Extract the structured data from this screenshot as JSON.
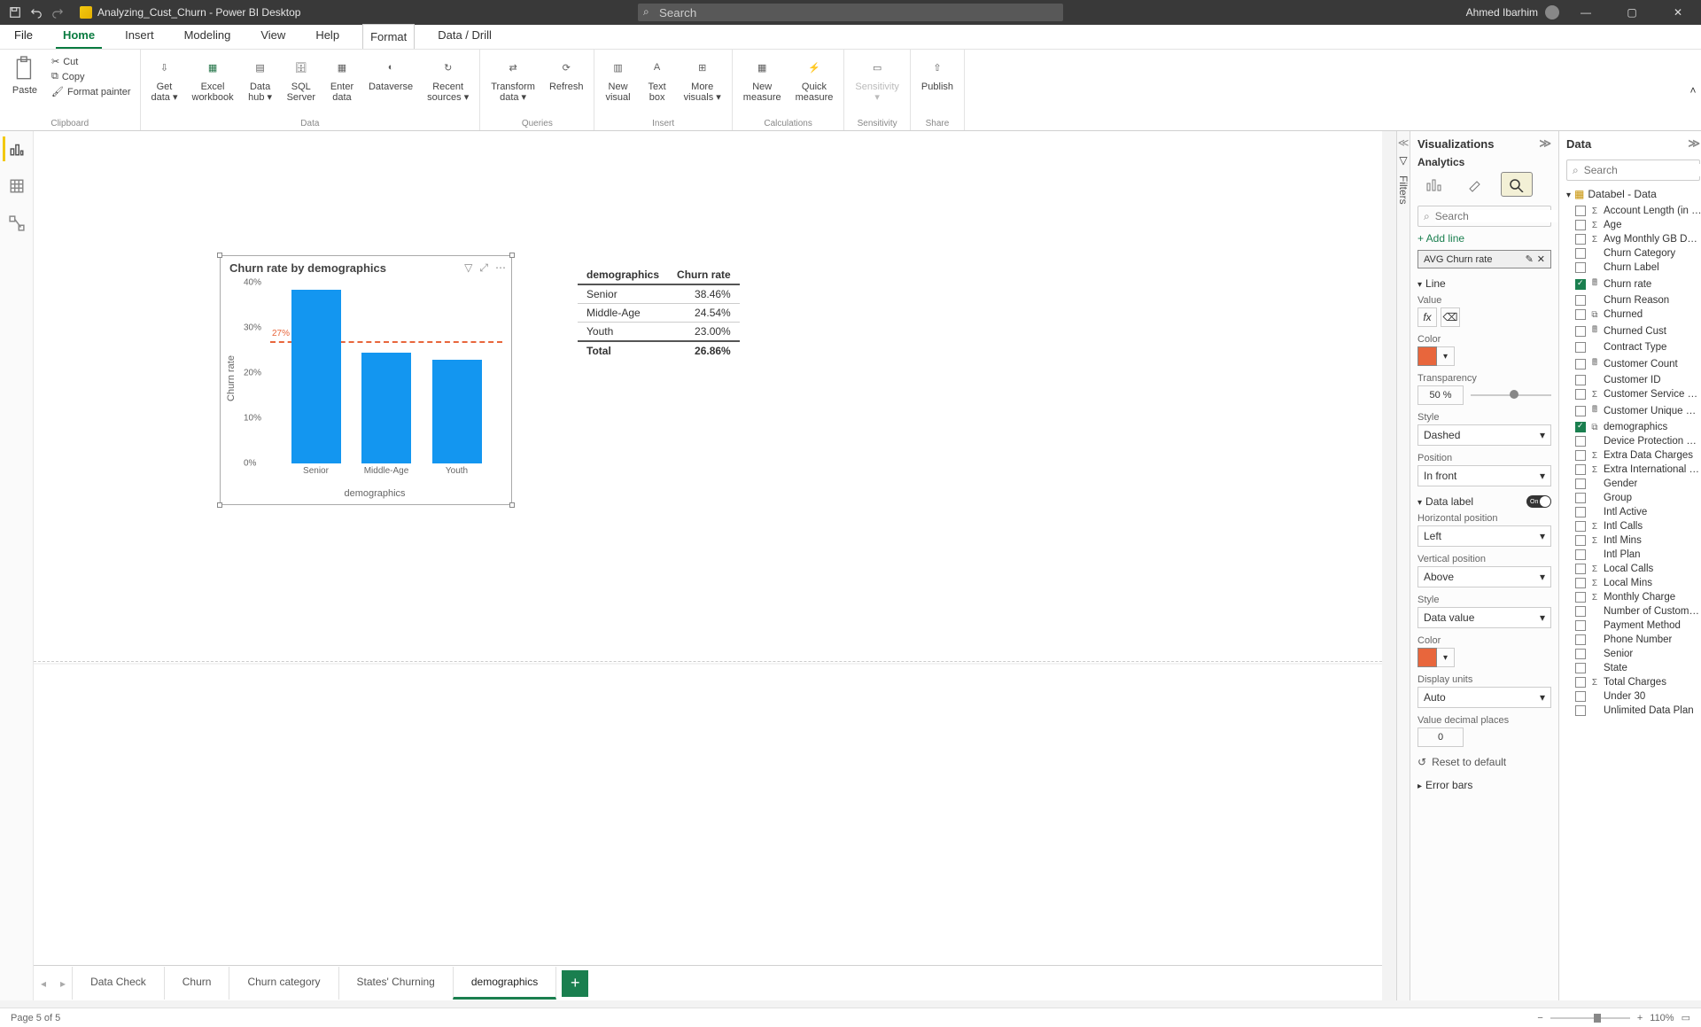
{
  "titlebar": {
    "doc_name": "Analyzing_Cust_Churn - Power BI Desktop",
    "search_placeholder": "Search",
    "user_name": "Ahmed Ibarhim"
  },
  "menus": [
    "File",
    "Home",
    "Insert",
    "Modeling",
    "View",
    "Help",
    "Format",
    "Data / Drill"
  ],
  "ribbon": {
    "clipboard": {
      "paste": "Paste",
      "cut": "Cut",
      "copy": "Copy",
      "format_painter": "Format painter",
      "group": "Clipboard"
    },
    "data": {
      "get": "Get\ndata ▾",
      "excel": "Excel\nworkbook",
      "datahub": "Data\nhub ▾",
      "sql": "SQL\nServer",
      "enter": "Enter\ndata",
      "dataverse": "Dataverse",
      "recent": "Recent\nsources ▾",
      "group": "Data"
    },
    "queries": {
      "transform": "Transform\ndata ▾",
      "refresh": "Refresh",
      "group": "Queries"
    },
    "insert": {
      "visual": "New\nvisual",
      "textbox": "Text\nbox",
      "more": "More\nvisuals ▾",
      "group": "Insert"
    },
    "calculations": {
      "measure": "New\nmeasure",
      "quick": "Quick\nmeasure",
      "group": "Calculations"
    },
    "sensitivity": {
      "label": "Sensitivity\n▾",
      "group": "Sensitivity"
    },
    "share": {
      "publish": "Publish",
      "group": "Share"
    }
  },
  "chart_data": {
    "type": "bar",
    "title": "Churn rate by demographics",
    "ylabel": "Churn rate",
    "xlabel": "demographics",
    "ylim": [
      0,
      40
    ],
    "yticks": [
      0,
      10,
      20,
      30,
      40
    ],
    "categories": [
      "Senior",
      "Middle-Age",
      "Youth"
    ],
    "values": [
      38.46,
      24.54,
      23.0
    ],
    "reference_line": {
      "value": 27,
      "label": "27%"
    }
  },
  "summary_table": {
    "headers": [
      "demographics",
      "Churn rate"
    ],
    "rows": [
      [
        "Senior",
        "38.46%"
      ],
      [
        "Middle-Age",
        "24.54%"
      ],
      [
        "Youth",
        "23.00%"
      ]
    ],
    "total": [
      "Total",
      "26.86%"
    ]
  },
  "page_tabs": {
    "tabs": [
      "Data Check",
      "Churn",
      "Churn category",
      "States' Churning",
      "demographics"
    ],
    "active_index": 4
  },
  "status": {
    "page": "Page 5 of 5",
    "zoom": "110%"
  },
  "filters_rail": {
    "label": "Filters"
  },
  "viz_pane": {
    "title": "Visualizations",
    "subtab": "Analytics",
    "search_placeholder": "Search",
    "add_line": "+ Add line",
    "line_chip": "AVG Churn rate",
    "sections": {
      "line": "Line",
      "value_label": "Value",
      "color_label": "Color",
      "transparency_label": "Transparency",
      "transparency_val": "50 %",
      "style_label": "Style",
      "style_val": "Dashed",
      "position_label": "Position",
      "position_val": "In front",
      "datalabel": "Data label",
      "datalabel_toggle": "On",
      "hpos_label": "Horizontal position",
      "hpos_val": "Left",
      "vpos_label": "Vertical position",
      "vpos_val": "Above",
      "dstyle_label": "Style",
      "dstyle_val": "Data value",
      "dcolor_label": "Color",
      "dunits_label": "Display units",
      "dunits_val": "Auto",
      "vdec_label": "Value decimal places",
      "vdec_val": "0",
      "reset": "Reset to default",
      "errorbars": "Error bars"
    }
  },
  "data_pane": {
    "title": "Data",
    "search_placeholder": "Search",
    "table": "Databel - Data",
    "fields": [
      {
        "name": "Account Length (in mont...",
        "sigma": true,
        "checked": false
      },
      {
        "name": "Age",
        "sigma": true,
        "checked": false
      },
      {
        "name": "Avg Monthly GB Download",
        "sigma": true,
        "checked": false
      },
      {
        "name": "Churn Category",
        "sigma": false,
        "checked": false
      },
      {
        "name": "Churn Label",
        "sigma": false,
        "checked": false
      },
      {
        "name": "Churn rate",
        "sigma": false,
        "icon": "calc",
        "checked": true
      },
      {
        "name": "Churn Reason",
        "sigma": false,
        "checked": false
      },
      {
        "name": "Churned",
        "sigma": false,
        "icon": "hier",
        "checked": false
      },
      {
        "name": "Churned Cust",
        "sigma": false,
        "icon": "calc",
        "checked": false
      },
      {
        "name": "Contract Type",
        "sigma": false,
        "checked": false
      },
      {
        "name": "Customer Count",
        "sigma": false,
        "icon": "calc",
        "checked": false
      },
      {
        "name": "Customer ID",
        "sigma": false,
        "checked": false
      },
      {
        "name": "Customer Service Calls",
        "sigma": true,
        "checked": false
      },
      {
        "name": "Customer Unique Count",
        "sigma": false,
        "icon": "calc",
        "checked": false
      },
      {
        "name": "demographics",
        "sigma": false,
        "icon": "hier",
        "checked": true
      },
      {
        "name": "Device Protection & Onli...",
        "sigma": false,
        "checked": false
      },
      {
        "name": "Extra Data Charges",
        "sigma": true,
        "checked": false
      },
      {
        "name": "Extra International Charges",
        "sigma": true,
        "checked": false
      },
      {
        "name": "Gender",
        "sigma": false,
        "checked": false
      },
      {
        "name": "Group",
        "sigma": false,
        "checked": false
      },
      {
        "name": "Intl Active",
        "sigma": false,
        "checked": false
      },
      {
        "name": "Intl Calls",
        "sigma": true,
        "checked": false
      },
      {
        "name": "Intl Mins",
        "sigma": true,
        "checked": false
      },
      {
        "name": "Intl Plan",
        "sigma": false,
        "checked": false
      },
      {
        "name": "Local Calls",
        "sigma": true,
        "checked": false
      },
      {
        "name": "Local Mins",
        "sigma": true,
        "checked": false
      },
      {
        "name": "Monthly Charge",
        "sigma": true,
        "checked": false
      },
      {
        "name": "Number of Customers in ...",
        "sigma": false,
        "checked": false
      },
      {
        "name": "Payment Method",
        "sigma": false,
        "checked": false
      },
      {
        "name": "Phone Number",
        "sigma": false,
        "checked": false
      },
      {
        "name": "Senior",
        "sigma": false,
        "checked": false
      },
      {
        "name": "State",
        "sigma": false,
        "checked": false
      },
      {
        "name": "Total Charges",
        "sigma": true,
        "checked": false
      },
      {
        "name": "Under 30",
        "sigma": false,
        "checked": false
      },
      {
        "name": "Unlimited Data Plan",
        "sigma": false,
        "checked": false
      }
    ]
  }
}
